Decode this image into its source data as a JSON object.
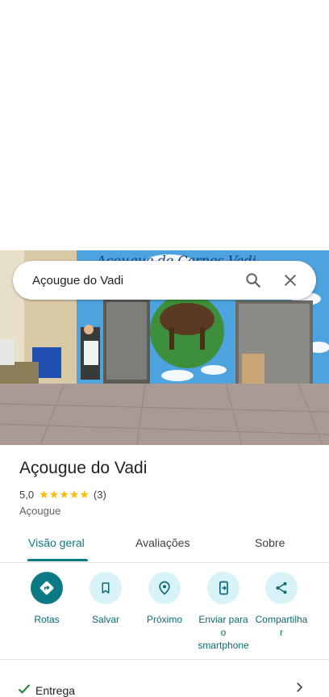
{
  "search": {
    "query": "Açougue do Vadi",
    "search_icon": "search-icon",
    "close_icon": "close-icon"
  },
  "photo": {
    "sign_text": "Açougue de Carnes Vadi"
  },
  "place": {
    "name": "Açougue do Vadi",
    "rating": "5,0",
    "stars": 5,
    "reviews_count": "(3)",
    "category": "Açougue"
  },
  "tabs": [
    {
      "label": "Visão geral",
      "active": true
    },
    {
      "label": "Avaliações",
      "active": false
    },
    {
      "label": "Sobre",
      "active": false
    }
  ],
  "actions": [
    {
      "label": "Rotas",
      "icon": "directions-icon"
    },
    {
      "label": "Salvar",
      "icon": "bookmark-icon"
    },
    {
      "label": "Próximo",
      "icon": "nearby-icon"
    },
    {
      "label": "Enviar para o smartphone",
      "label_line1": "Enviar para",
      "label_line2": "o",
      "label_line3": "smartphone",
      "icon": "send-to-phone-icon"
    },
    {
      "label": "Compartilhar",
      "label_line1": "Compartilha",
      "label_line2": "r",
      "icon": "share-icon"
    }
  ],
  "features": [
    {
      "label": "Entrega",
      "icon": "check-icon"
    }
  ],
  "colors": {
    "accent": "#0b7a84",
    "accent_light": "#d8f3f8",
    "star": "#fbbc04",
    "check": "#188038"
  }
}
